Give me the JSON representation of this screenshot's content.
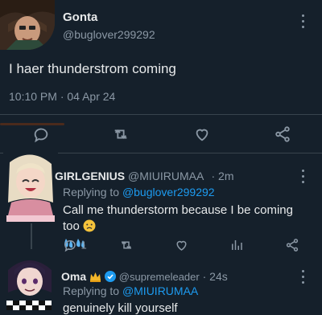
{
  "main_tweet": {
    "display_name": "Gonta",
    "handle": "@buglover299292",
    "text": "I haer thunderstrom coming",
    "time": "10:10 PM",
    "separator": "·",
    "date": "04 Apr 24"
  },
  "reply1": {
    "display_name": "GIRLGENIUS",
    "handle": "@MIUIRUMAA",
    "separator": "·",
    "time_ago": "2m",
    "replying_prefix": "Replying to",
    "replying_to": "@buglover299292",
    "text": "Call me thunderstorm because I be coming too",
    "reply_count": "1"
  },
  "reply2": {
    "display_name": "Oma",
    "handle": "@supremeleader",
    "separator": "·",
    "time_ago": "24s",
    "replying_prefix": "Replying to",
    "replying_to": "@MIUIRUMAA",
    "text": "genuinely kill yourself"
  },
  "colors": {
    "background": "#15202b",
    "accent": "#1d9bf0",
    "muted": "#8b98a5",
    "text": "#e7e9ea"
  },
  "icons": [
    "reply-icon",
    "retweet-icon",
    "like-icon",
    "share-icon",
    "views-icon",
    "more-icon",
    "verified-badge-icon",
    "crown-icon",
    "worried-face-icon",
    "sweat-droplets-icon"
  ]
}
